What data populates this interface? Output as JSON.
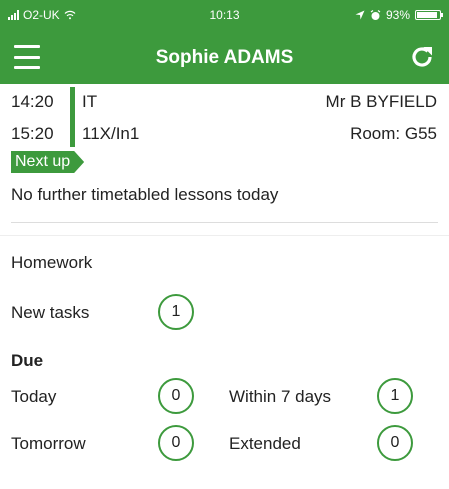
{
  "status_bar": {
    "carrier": "O2-UK",
    "time": "10:13",
    "battery_percent": "93%",
    "battery_level": 0.93
  },
  "header": {
    "title": "Sophie ADAMS"
  },
  "lessons": [
    {
      "time": "14:20",
      "subject": "IT",
      "right_text": "Mr B BYFIELD"
    },
    {
      "time": "15:20",
      "subject": "11X/In1",
      "right_text": "Room: G55"
    }
  ],
  "next_up": {
    "label": "Next up",
    "message": "No further timetabled lessons today"
  },
  "homework": {
    "heading": "Homework",
    "new_tasks_label": "New tasks",
    "new_tasks_count": "1",
    "due_heading": "Due",
    "today_label": "Today",
    "today_count": "0",
    "within_7_days_label": "Within 7 days",
    "within_7_days_count": "1",
    "tomorrow_label": "Tomorrow",
    "tomorrow_count": "0",
    "extended_label": "Extended",
    "extended_count": "0"
  },
  "colors": {
    "brand_green": "#3d9a3d"
  }
}
